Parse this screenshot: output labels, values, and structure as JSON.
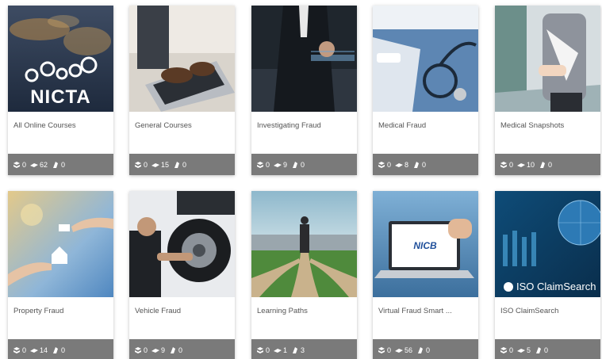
{
  "courses": [
    {
      "title": "All Online Courses",
      "logo_text": "NICTA",
      "stats": {
        "courses": "0",
        "modules": "62",
        "certificates": "0"
      }
    },
    {
      "title": "General Courses",
      "stats": {
        "courses": "0",
        "modules": "15",
        "certificates": "0"
      }
    },
    {
      "title": "Investigating Fraud",
      "stats": {
        "courses": "0",
        "modules": "9",
        "certificates": "0"
      }
    },
    {
      "title": "Medical Fraud",
      "stats": {
        "courses": "0",
        "modules": "8",
        "certificates": "0"
      }
    },
    {
      "title": "Medical Snapshots",
      "stats": {
        "courses": "0",
        "modules": "10",
        "certificates": "0"
      }
    },
    {
      "title": "Property Fraud",
      "stats": {
        "courses": "0",
        "modules": "14",
        "certificates": "0"
      }
    },
    {
      "title": "Vehicle Fraud",
      "stats": {
        "courses": "0",
        "modules": "9",
        "certificates": "0"
      }
    },
    {
      "title": "Learning Paths",
      "stats": {
        "courses": "0",
        "modules": "1",
        "certificates": "3"
      }
    },
    {
      "title": "Virtual Fraud Smart ...",
      "logo_text": "NICB",
      "stats": {
        "courses": "0",
        "modules": "56",
        "certificates": "0"
      }
    },
    {
      "title": "ISO ClaimSearch",
      "logo_text": "ISO ClaimSearch",
      "stats": {
        "courses": "0",
        "modules": "5",
        "certificates": "0"
      }
    }
  ],
  "icons": {
    "courses": "books-icon",
    "modules": "module-icon",
    "certificates": "certificate-icon"
  },
  "colors": {
    "stats_bar": "#7a7a7a",
    "title_text": "#555555"
  }
}
